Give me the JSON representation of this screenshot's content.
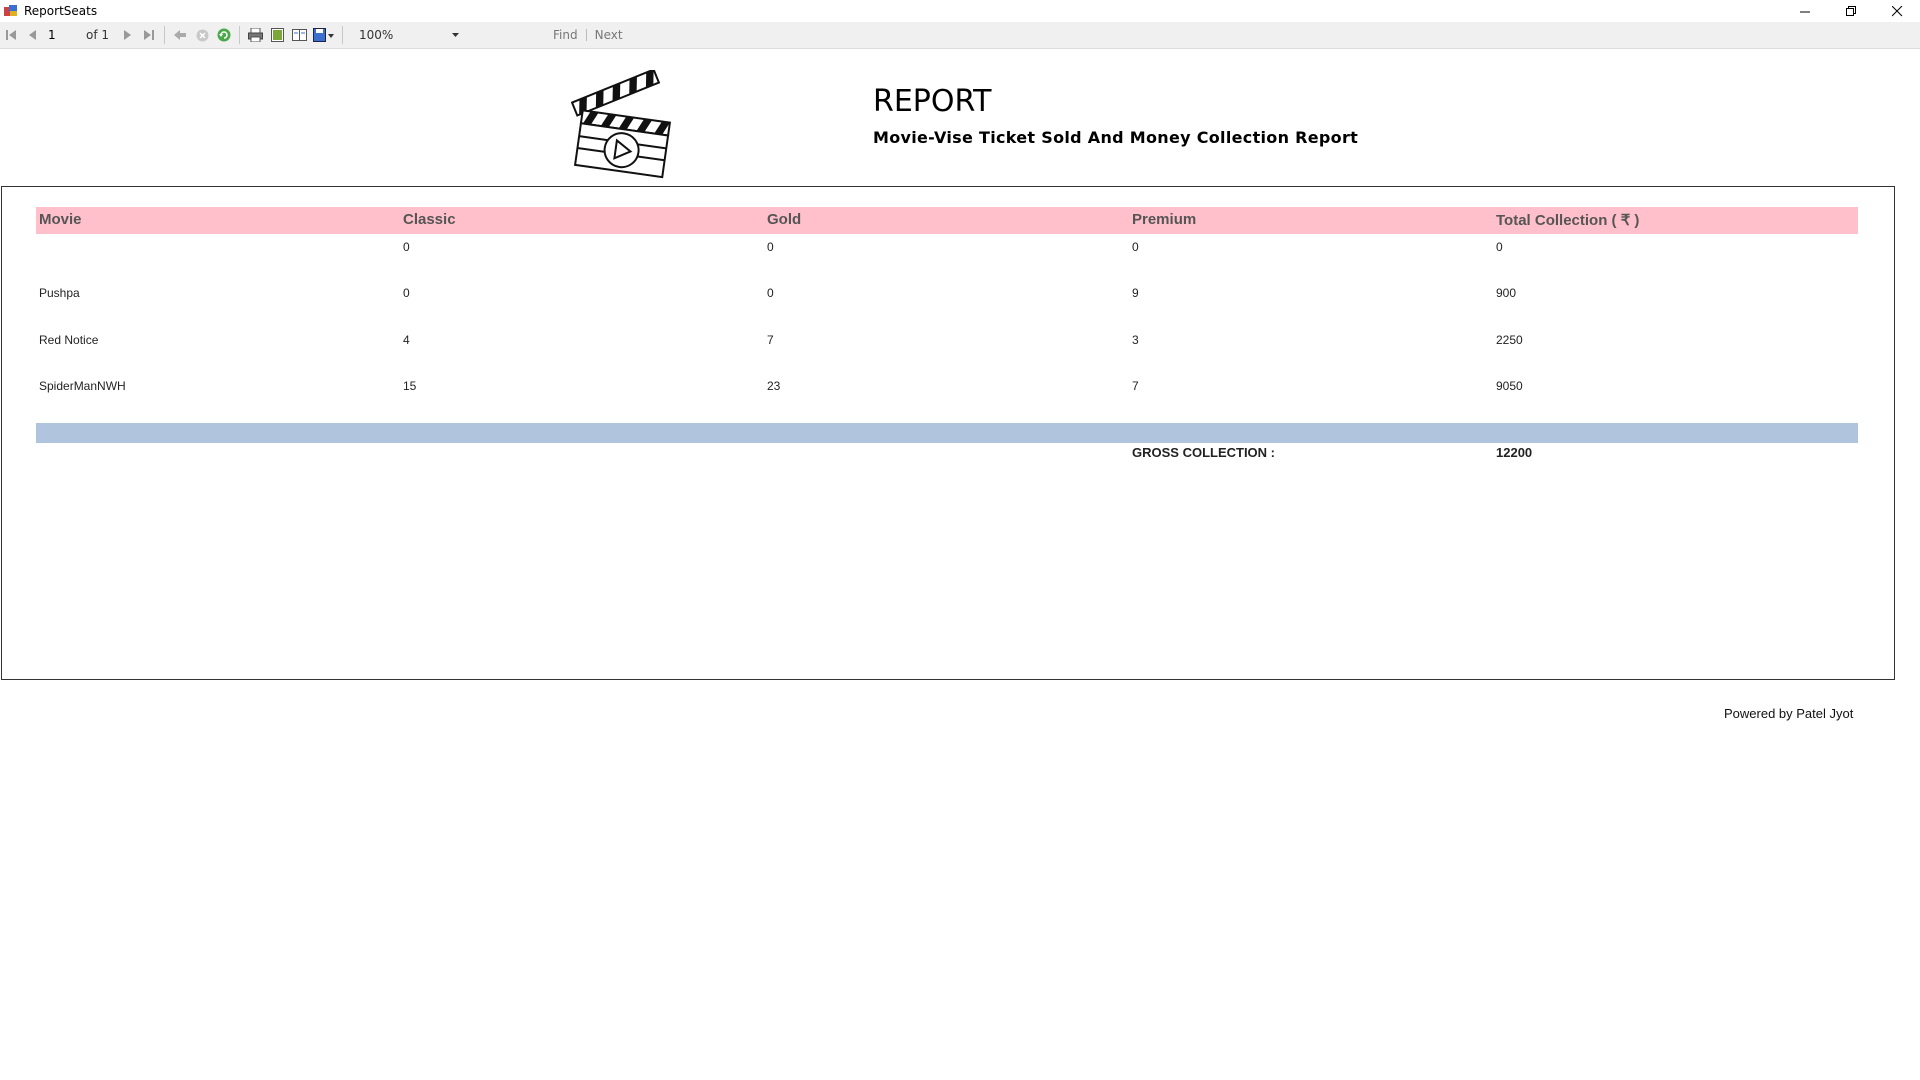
{
  "window": {
    "title": "ReportSeats"
  },
  "toolbar": {
    "page_number": "1",
    "page_of": "of 1",
    "zoom": "100%",
    "find_label": "Find",
    "next_label": "Next"
  },
  "report": {
    "title": "REPORT",
    "subtitle": "Movie-Vise Ticket Sold And Money Collection Report",
    "columns": [
      "Movie",
      "Classic",
      "Gold",
      "Premium",
      "Total Collection ( ₹ )"
    ],
    "rows": [
      [
        "",
        "0",
        "0",
        "0",
        "0"
      ],
      [
        "Pushpa",
        "0",
        "0",
        "9",
        "900"
      ],
      [
        "Red Notice",
        "4",
        "7",
        "3",
        "2250"
      ],
      [
        "SpiderManNWH",
        "15",
        "23",
        "7",
        "9050"
      ]
    ],
    "gross_label": "GROSS COLLECTION :",
    "gross_value": "12200",
    "footer": "Powered by Patel Jyot"
  },
  "colors": {
    "header_row": "#ffc0cb",
    "total_bar": "#b0c4de"
  }
}
